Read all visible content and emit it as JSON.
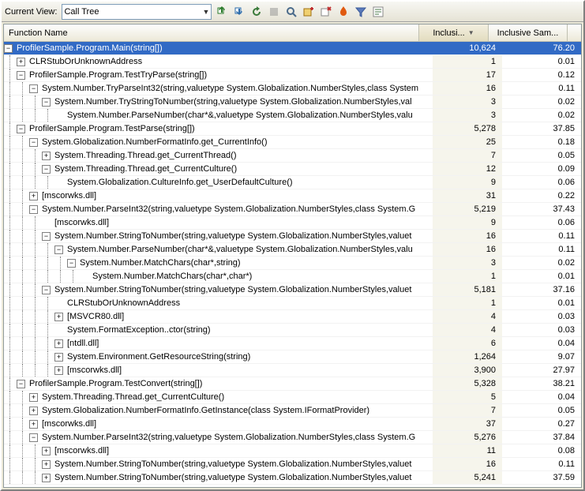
{
  "toolbar": {
    "view_label": "Current View:",
    "view_value": "Call Tree"
  },
  "columns": {
    "name": "Function Name",
    "inclusive": "Inclusi...",
    "inclusive_samples": "Inclusive Sam..."
  },
  "rows": [
    {
      "depth": 0,
      "exp": "-",
      "name": "ProfilerSample.Program.Main(string[])",
      "inc": "10,624",
      "incs": "76.20",
      "selected": true
    },
    {
      "depth": 1,
      "exp": "+",
      "name": "CLRStubOrUnknownAddress",
      "inc": "1",
      "incs": "0.01"
    },
    {
      "depth": 1,
      "exp": "-",
      "name": "ProfilerSample.Program.TestTryParse(string[])",
      "inc": "17",
      "incs": "0.12"
    },
    {
      "depth": 2,
      "exp": "-",
      "name": "System.Number.TryParseInt32(string,valuetype System.Globalization.NumberStyles,class System",
      "inc": "16",
      "incs": "0.11"
    },
    {
      "depth": 3,
      "exp": "-",
      "name": "System.Number.TryStringToNumber(string,valuetype System.Globalization.NumberStyles,val",
      "inc": "3",
      "incs": "0.02"
    },
    {
      "depth": 4,
      "exp": "",
      "name": "System.Number.ParseNumber(char*&,valuetype System.Globalization.NumberStyles,valu",
      "inc": "3",
      "incs": "0.02"
    },
    {
      "depth": 1,
      "exp": "-",
      "name": "ProfilerSample.Program.TestParse(string[])",
      "inc": "5,278",
      "incs": "37.85"
    },
    {
      "depth": 2,
      "exp": "-",
      "name": "System.Globalization.NumberFormatInfo.get_CurrentInfo()",
      "inc": "25",
      "incs": "0.18"
    },
    {
      "depth": 3,
      "exp": "+",
      "name": "System.Threading.Thread.get_CurrentThread()",
      "inc": "7",
      "incs": "0.05"
    },
    {
      "depth": 3,
      "exp": "-",
      "name": "System.Threading.Thread.get_CurrentCulture()",
      "inc": "12",
      "incs": "0.09"
    },
    {
      "depth": 4,
      "exp": "",
      "name": "System.Globalization.CultureInfo.get_UserDefaultCulture()",
      "inc": "9",
      "incs": "0.06"
    },
    {
      "depth": 2,
      "exp": "+",
      "name": "[mscorwks.dll]",
      "inc": "31",
      "incs": "0.22"
    },
    {
      "depth": 2,
      "exp": "-",
      "name": "System.Number.ParseInt32(string,valuetype System.Globalization.NumberStyles,class System.G",
      "inc": "5,219",
      "incs": "37.43"
    },
    {
      "depth": 3,
      "exp": "",
      "name": "[mscorwks.dll]",
      "inc": "9",
      "incs": "0.06"
    },
    {
      "depth": 3,
      "exp": "-",
      "name": "System.Number.StringToNumber(string,valuetype System.Globalization.NumberStyles,valuet",
      "inc": "16",
      "incs": "0.11"
    },
    {
      "depth": 4,
      "exp": "-",
      "name": "System.Number.ParseNumber(char*&,valuetype System.Globalization.NumberStyles,valu",
      "inc": "16",
      "incs": "0.11"
    },
    {
      "depth": 5,
      "exp": "-",
      "name": "System.Number.MatchChars(char*,string)",
      "inc": "3",
      "incs": "0.02"
    },
    {
      "depth": 6,
      "exp": "",
      "name": "System.Number.MatchChars(char*,char*)",
      "inc": "1",
      "incs": "0.01"
    },
    {
      "depth": 3,
      "exp": "-",
      "name": "System.Number.StringToNumber(string,valuetype System.Globalization.NumberStyles,valuet",
      "inc": "5,181",
      "incs": "37.16"
    },
    {
      "depth": 4,
      "exp": "",
      "name": "CLRStubOrUnknownAddress",
      "inc": "1",
      "incs": "0.01"
    },
    {
      "depth": 4,
      "exp": "+",
      "name": "[MSVCR80.dll]",
      "inc": "4",
      "incs": "0.03"
    },
    {
      "depth": 4,
      "exp": "",
      "name": "System.FormatException..ctor(string)",
      "inc": "4",
      "incs": "0.03"
    },
    {
      "depth": 4,
      "exp": "+",
      "name": "[ntdll.dll]",
      "inc": "6",
      "incs": "0.04"
    },
    {
      "depth": 4,
      "exp": "+",
      "name": "System.Environment.GetResourceString(string)",
      "inc": "1,264",
      "incs": "9.07"
    },
    {
      "depth": 4,
      "exp": "+",
      "name": "[mscorwks.dll]",
      "inc": "3,900",
      "incs": "27.97"
    },
    {
      "depth": 1,
      "exp": "-",
      "name": "ProfilerSample.Program.TestConvert(string[])",
      "inc": "5,328",
      "incs": "38.21"
    },
    {
      "depth": 2,
      "exp": "+",
      "name": "System.Threading.Thread.get_CurrentCulture()",
      "inc": "5",
      "incs": "0.04"
    },
    {
      "depth": 2,
      "exp": "+",
      "name": "System.Globalization.NumberFormatInfo.GetInstance(class System.IFormatProvider)",
      "inc": "7",
      "incs": "0.05"
    },
    {
      "depth": 2,
      "exp": "+",
      "name": "[mscorwks.dll]",
      "inc": "37",
      "incs": "0.27"
    },
    {
      "depth": 2,
      "exp": "-",
      "name": "System.Number.ParseInt32(string,valuetype System.Globalization.NumberStyles,class System.G",
      "inc": "5,276",
      "incs": "37.84"
    },
    {
      "depth": 3,
      "exp": "+",
      "name": "[mscorwks.dll]",
      "inc": "11",
      "incs": "0.08"
    },
    {
      "depth": 3,
      "exp": "+",
      "name": "System.Number.StringToNumber(string,valuetype System.Globalization.NumberStyles,valuet",
      "inc": "16",
      "incs": "0.11"
    },
    {
      "depth": 3,
      "exp": "+",
      "name": "System.Number.StringToNumber(string,valuetype System.Globalization.NumberStyles,valuet",
      "inc": "5,241",
      "incs": "37.59"
    }
  ]
}
